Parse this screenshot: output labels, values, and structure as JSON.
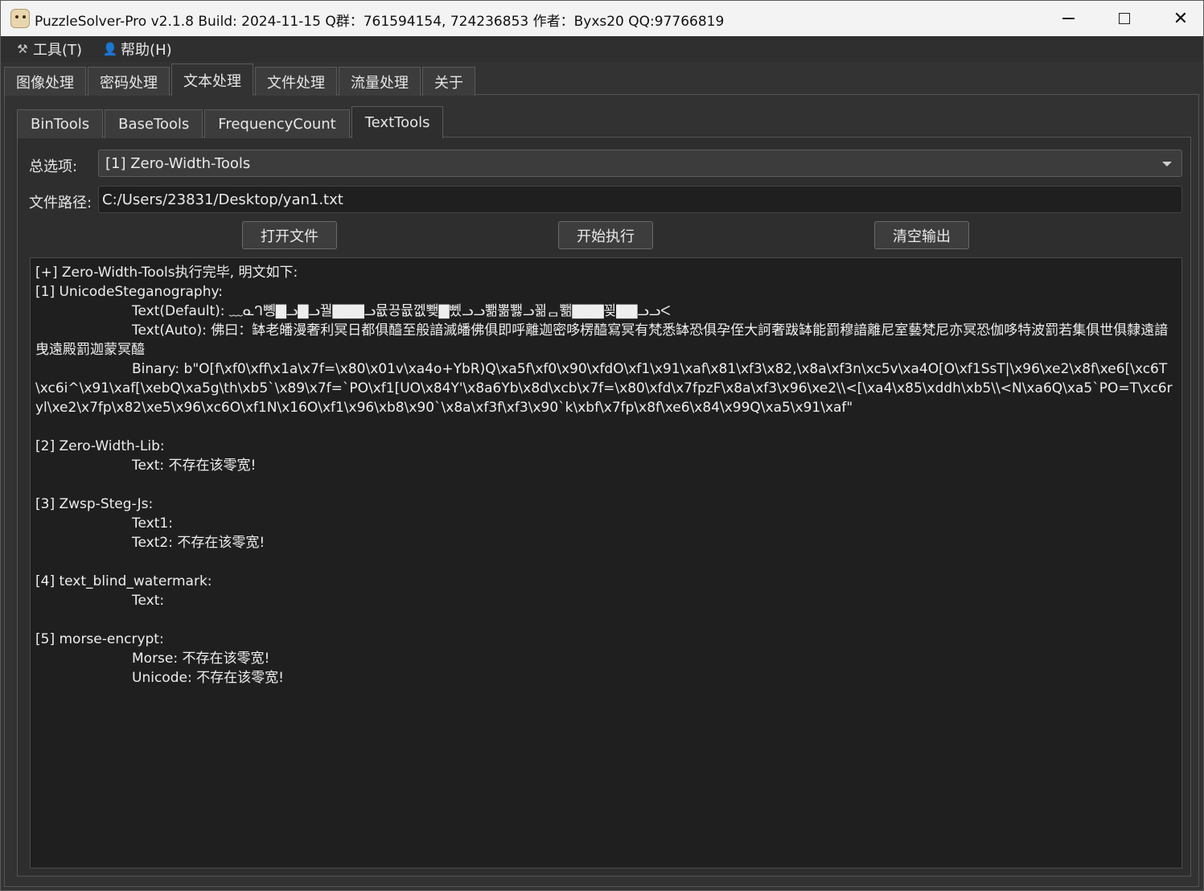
{
  "window": {
    "title": "PuzzleSolver-Pro v2.1.8  Build: 2024-11-15  Q群：761594154, 724236853  作者：Byxs20  QQ:97766819"
  },
  "menu": {
    "tools": "工具(T)",
    "help": "帮助(H)"
  },
  "top_tabs": [
    "图像处理",
    "密码处理",
    "文本处理",
    "文件处理",
    "流量处理",
    "关于"
  ],
  "top_tab_active": "文本处理",
  "sub_tabs": [
    "BinTools",
    "BaseTools",
    "FrequencyCount",
    "TextTools"
  ],
  "sub_tab_active": "TextTools",
  "form": {
    "option_label": "总选项:",
    "option_value": "[1] Zero-Width-Tools",
    "path_label": "文件路径:",
    "path_value": "C:/Users/23831/Desktop/yan1.txt"
  },
  "buttons": {
    "open": "打开文件",
    "run": "开始执行",
    "clear": "清空输出"
  },
  "output": {
    "l1": "[+] Zero-Width-Tools执行完毕, 明文如下:",
    "l2": "[1] UnicodeSteganography:",
    "l3": "Text(Default): ﹏ᓇᒉ뼹▇ᓗ▇ᓗ꿜▇▇▇ᓗ뮶끙뮶껪뾎▇뼀ᓗᓗ뾂뽊뾇ᓗ꾊ᆷ뾂▇▇▇꾖▇▇ᓗᓗᐸ",
    "l4": "Text(Auto): 佛曰：缽老皤漫奢利冥日都俱醯至般諳滅皤佛俱即呼離迦密哆楞醯寫冥有梵悉缽恐俱孕侄大訶奢跋缽能罰穆諳離尼室藝梵尼亦冥恐伽哆特波罰若集俱世俱隸遠諳曳遠殿罰迦蒙冥醯",
    "l5": "Binary: b\"O[f\\xf0\\xff\\x1a\\x7f=\\x80\\x01v\\xa4o+YbR)Q\\xa5f\\xf0\\x90\\xfdO\\xf1\\x91\\xaf\\x81\\xf3\\x82,\\x8a\\xf3n\\xc5v\\xa4O[O\\xf1SsT|\\x96\\xe2\\x8f\\xe6[\\xc6T\\xc6i^\\x91\\xaf[\\xebQ\\xa5g\\th\\xb5`\\x89\\x7f=`PO\\xf1[UO\\x84Y'\\x8a6Yb\\x8d\\xcb\\x7f=\\x80\\xfd\\x7fpzF\\x8a\\xf3\\x96\\xe2\\\\<[\\xa4\\x85\\xddh\\xb5\\\\<N\\xa6Q\\xa5`PO=T\\xc6ryl\\xe2\\x7fp\\x82\\xe5\\x96\\xc6O\\xf1N\\x16O\\xf1\\x96\\xb8\\x90`\\x8a\\xf3f\\xf3\\x90`k\\xbf\\x7fp\\x8f\\xe6\\x84\\x99Q\\xa5\\x91\\xaf\"",
    "l6": "[2] Zero-Width-Lib:",
    "l7": "Text: 不存在该零宽!",
    "l8": "[3] Zwsp-Steg-Js:",
    "l9": "Text1:",
    "l10": "Text2: 不存在该零宽!",
    "l11": "[4] text_blind_watermark:",
    "l12": "Text:",
    "l13": "[5] morse-encrypt:",
    "l14": "Morse: 不存在该零宽!",
    "l15": "Unicode: 不存在该零宽!"
  }
}
